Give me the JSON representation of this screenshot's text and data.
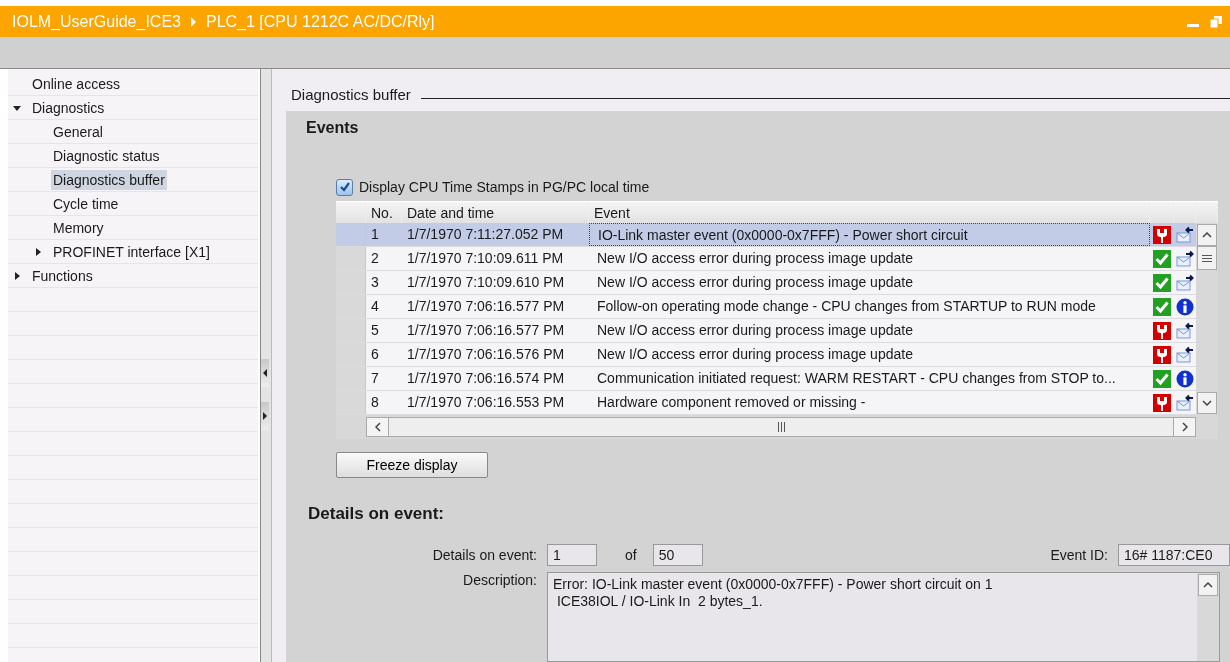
{
  "window": {
    "title_project": "IOLM_UserGuide_ICE3",
    "title_device": "PLC_1 [CPU 1212C AC/DC/Rly]"
  },
  "sidebar": {
    "items": [
      {
        "label": "Online access",
        "selected": false
      },
      {
        "label": "Diagnostics",
        "selected": false,
        "expanded": true,
        "children": [
          {
            "label": "General",
            "selected": false
          },
          {
            "label": "Diagnostic status",
            "selected": false
          },
          {
            "label": "Diagnostics buffer",
            "selected": true
          },
          {
            "label": "Cycle time",
            "selected": false
          },
          {
            "label": "Memory",
            "selected": false
          },
          {
            "label": "PROFINET interface [X1]",
            "selected": false,
            "expanded": false
          }
        ]
      },
      {
        "label": "Functions",
        "selected": false,
        "expanded": false
      }
    ]
  },
  "page_title": "Diagnostics buffer",
  "events": {
    "title": "Events",
    "checkbox": {
      "label": "Display CPU Time Stamps in PG/PC local time",
      "checked": true
    },
    "table": {
      "columns": [
        "No.",
        "Date and time",
        "Event"
      ],
      "rows": [
        {
          "no": "1",
          "date": "1/7/1970 7:11:27.052 PM",
          "event": "IO-Link master event (0x0000-0x7FFF) - Power short circuit",
          "kind": "incoming",
          "selected": true
        },
        {
          "no": "2",
          "date": "1/7/1970 7:10:09.611 PM",
          "event": "New I/O access error during process image update",
          "kind": "outgoing",
          "selected": false
        },
        {
          "no": "3",
          "date": "1/7/1970 7:10:09.610 PM",
          "event": "New I/O access error during process image update",
          "kind": "outgoing",
          "selected": false
        },
        {
          "no": "4",
          "date": "1/7/1970 7:06:16.577 PM",
          "event": "Follow-on operating mode change  - CPU changes from STARTUP to RUN mode",
          "kind": "info",
          "selected": false
        },
        {
          "no": "5",
          "date": "1/7/1970 7:06:16.577 PM",
          "event": "New I/O access error during process image update",
          "kind": "incoming",
          "selected": false
        },
        {
          "no": "6",
          "date": "1/7/1970 7:06:16.576 PM",
          "event": "New I/O access error during process image update",
          "kind": "incoming",
          "selected": false
        },
        {
          "no": "7",
          "date": "1/7/1970 7:06:16.574 PM",
          "event": "Communication initiated request: WARM RESTART  - CPU changes from STOP to...",
          "kind": "info",
          "selected": false
        },
        {
          "no": "8",
          "date": "1/7/1970 7:06:16.553 PM",
          "event": "Hardware component removed or missing -",
          "kind": "incoming",
          "selected": false
        }
      ]
    },
    "freeze_button": "Freeze display"
  },
  "details": {
    "title": "Details on event:",
    "event_label": "Details on event:",
    "event_value": "1",
    "of_label": "of",
    "total_value": "50",
    "event_id_label": "Event ID:",
    "event_id_value": "16# 1187:CE0",
    "description_label": "Description:",
    "description": "Error: IO-Link master event (0x0000-0x7FFF) - Power short circuit on 1\n ICE38IOL / IO-Link In  2 bytes_1."
  }
}
